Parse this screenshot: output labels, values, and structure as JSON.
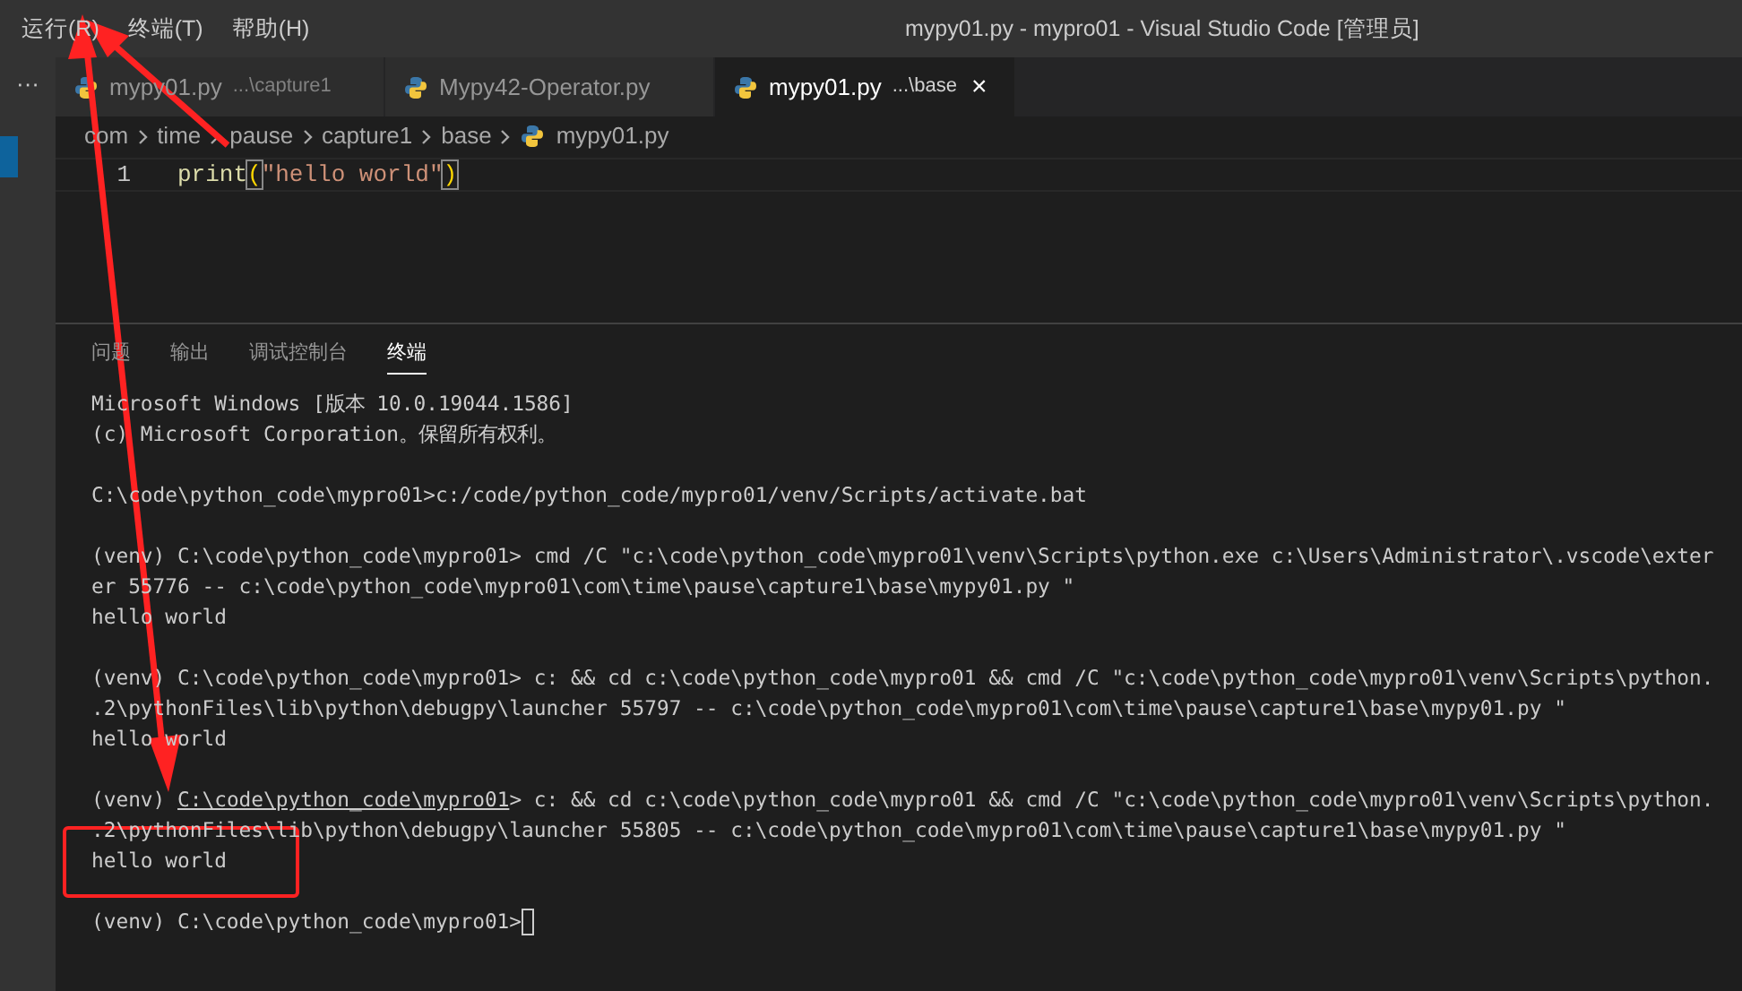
{
  "menu": [
    "运行(R)",
    "终端(T)",
    "帮助(H)"
  ],
  "window": {
    "title": "mypy01.py - mypro01 - Visual Studio Code [管理员]"
  },
  "activity_bar": {
    "more": "···"
  },
  "tabs": [
    {
      "label": "mypy01.py",
      "path": "...\\capture1",
      "selected": false
    },
    {
      "label": "Mypy42-Operator.py",
      "selected": false
    },
    {
      "label": "mypy01.py",
      "path": "...\\base",
      "selected": true,
      "close": "×"
    }
  ],
  "breadcrumbs": [
    "com",
    "time",
    "pause",
    "capture1",
    "base",
    "mypy01.py"
  ],
  "editor": {
    "lines": [
      {
        "number": "1",
        "func": "print",
        "open": "(",
        "string": "\"hello world\"",
        "close": ")"
      }
    ]
  },
  "panel": {
    "tabs": [
      {
        "label": "问题",
        "selected": false
      },
      {
        "label": "输出",
        "selected": false
      },
      {
        "label": "调试控制台",
        "selected": false
      },
      {
        "label": "终端",
        "selected": true
      }
    ],
    "terminal": [
      {
        "text": "Microsoft Windows [版本 10.0.19044.1586]"
      },
      {
        "text": "(c) Microsoft Corporation。保留所有权利。"
      },
      {
        "blank_before": true,
        "text": "C:\\code\\python_code\\mypro01>c:/code/python_code/mypro01/venv/Scripts/activate.bat"
      },
      {
        "blank_before": true,
        "text": "(venv) C:\\code\\python_code\\mypro01> cmd /C \"c:\\code\\python_code\\mypro01\\venv\\Scripts\\python.exe c:\\Users\\Administrator\\.vscode\\exter"
      },
      {
        "text": "er 55776 -- c:\\code\\python_code\\mypro01\\com\\time\\pause\\capture1\\base\\mypy01.py \""
      },
      {
        "text": "hello world"
      },
      {
        "blank_before": true,
        "text": "(venv) C:\\code\\python_code\\mypro01> c: && cd c:\\code\\python_code\\mypro01 && cmd /C \"c:\\code\\python_code\\mypro01\\venv\\Scripts\\python."
      },
      {
        "text": ".2\\pythonFiles\\lib\\python\\debugpy\\launcher 55797 -- c:\\code\\python_code\\mypro01\\com\\time\\pause\\capture1\\base\\mypy01.py \""
      },
      {
        "text": "hello world"
      },
      {
        "blank_before": true,
        "prefix": "(venv) ",
        "link": "C:\\code\\python_code\\mypro01",
        "text": "> c: && cd c:\\code\\python_code\\mypro01 && cmd /C \"c:\\code\\python_code\\mypro01\\venv\\Scripts\\python."
      },
      {
        "text": ".2\\pythonFiles\\lib\\python\\debugpy\\launcher 55805 -- c:\\code\\python_code\\mypro01\\com\\time\\pause\\capture1\\base\\mypy01.py \""
      },
      {
        "text": "hello world"
      },
      {
        "blank_before": true,
        "text": "(venv) C:\\code\\python_code\\mypro01>",
        "cursor": true
      }
    ]
  }
}
